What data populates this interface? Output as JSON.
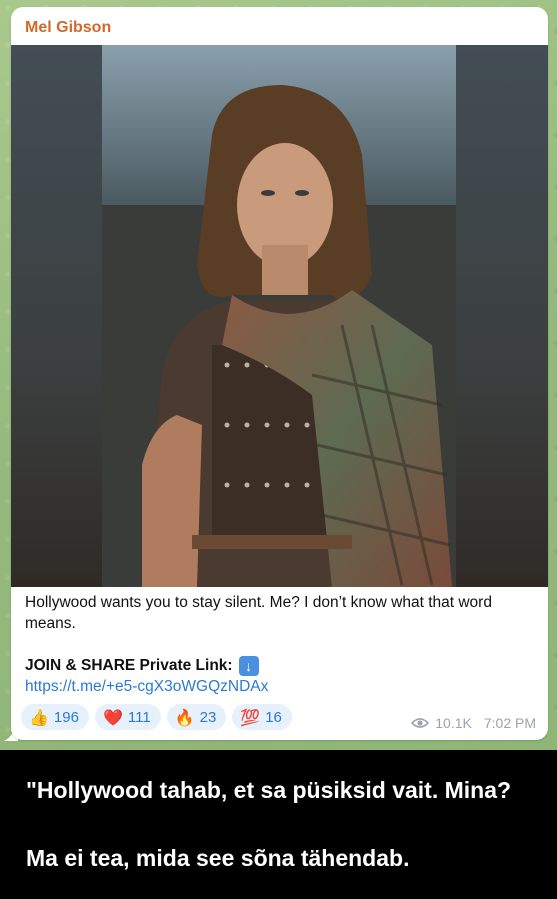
{
  "message": {
    "sender": "Mel Gibson",
    "caption": "Hollywood wants you to stay silent. Me? I don’t know what that word means.",
    "join_label": "JOIN & SHARE Private Link:",
    "join_icon": "down-arrow-icon",
    "link": "https://t.me/+e5-cgX3oWGQzNDAx",
    "reactions": [
      {
        "emoji": "👍",
        "icon": "thumbs-up-icon",
        "count": "196"
      },
      {
        "emoji": "❤️",
        "icon": "heart-icon",
        "count": "111"
      },
      {
        "emoji": "🔥",
        "icon": "fire-icon",
        "count": "23"
      },
      {
        "emoji": "💯",
        "icon": "hundred-points-icon",
        "count": "16"
      }
    ],
    "views": "10.1K",
    "time": "7:02 PM"
  },
  "overlay": {
    "line1": "\"Hollywood tahab, et sa püsiksid vait. Mina?",
    "line2": "Ma ei tea, mida see sõna tähendab."
  },
  "colors": {
    "sender": "#d06a2a",
    "link": "#2a7ad6",
    "reaction_bg": "#e6f1fb",
    "chat_bg": "#9fbf83"
  }
}
